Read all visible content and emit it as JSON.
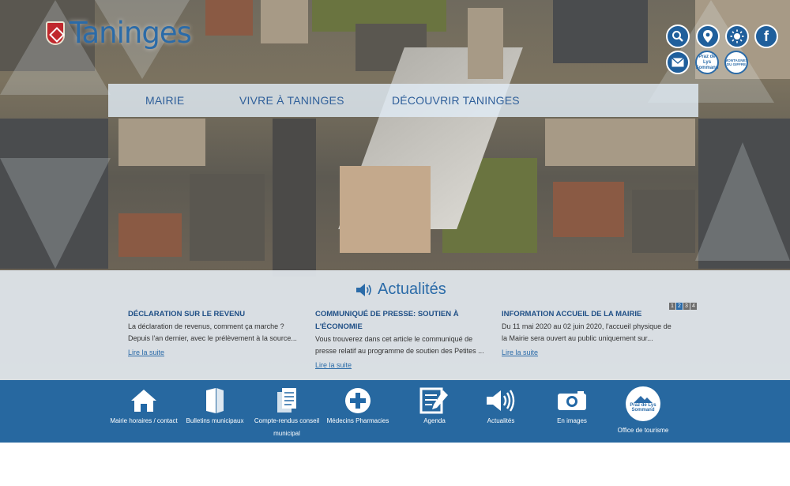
{
  "site": {
    "logo_text": "Taninges"
  },
  "top_icons": [
    {
      "name": "search-icon"
    },
    {
      "name": "location-icon"
    },
    {
      "name": "weather-icon"
    },
    {
      "name": "facebook-icon",
      "glyph": "f"
    },
    {
      "name": "mail-icon"
    },
    {
      "name": "praz-de-lys-badge",
      "label": "Praz de Lys Sommand"
    },
    {
      "name": "montagnes-giffre-badge",
      "label": "MONTAGNES DU GIFFRE"
    }
  ],
  "nav": {
    "items": [
      {
        "label": "MAIRIE"
      },
      {
        "label": "VIVRE À TANINGES"
      },
      {
        "label": "DÉCOUVRIR TANINGES"
      }
    ]
  },
  "news": {
    "title": "Actualités",
    "pages": [
      "1",
      "2",
      "3",
      "4"
    ],
    "active_page": "2",
    "articles": [
      {
        "title": "DÉCLARATION SUR LE REVENU",
        "excerpt": "La déclaration de revenus, comment ça marche ? Depuis l'an dernier, avec le prélèvement à la source...",
        "more": "Lire la suite"
      },
      {
        "title": "COMMUNIQUÉ DE PRESSE: SOUTIEN À L'ÉCONOMIE",
        "excerpt": "Vous trouverez dans cet article le communiqué de presse relatif au programme de soutien des Petites ...",
        "more": "Lire la suite"
      },
      {
        "title": "INFORMATION ACCUEIL DE LA MAIRIE",
        "excerpt": "Du 11 mai 2020 au 02 juin 2020, l'accueil physique de la Mairie sera ouvert au public uniquement sur...",
        "more": "Lire la suite"
      }
    ]
  },
  "quick_links": [
    {
      "label": "Mairie horaires / contact",
      "icon": "house-icon"
    },
    {
      "label": "Bulletins municipaux",
      "icon": "book-icon"
    },
    {
      "label": "Compte-rendus conseil municipal",
      "icon": "documents-icon"
    },
    {
      "label": "Médecins Pharmacies",
      "icon": "medical-cross-icon"
    },
    {
      "label": "Agenda",
      "icon": "agenda-icon"
    },
    {
      "label": "Actualités",
      "icon": "speaker-icon"
    },
    {
      "label": "En images",
      "icon": "camera-icon"
    },
    {
      "label": "Office de tourisme",
      "icon": "tourism-badge-icon",
      "badge_text": "Praz de Lys Sommand"
    }
  ],
  "colors": {
    "brand_blue": "#2b6ba8",
    "bar_blue": "#2268a6",
    "nav_text": "#2f5f9a",
    "heading_dark": "#1f4f86"
  }
}
